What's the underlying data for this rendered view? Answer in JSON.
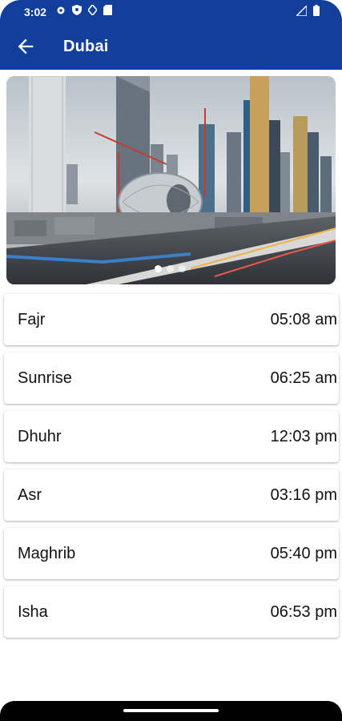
{
  "status_bar": {
    "time": "3:02",
    "left_icons": [
      "gear-icon",
      "shield-icon",
      "diamond-icon",
      "sim-card-icon"
    ],
    "right_icons": [
      "signal-icon",
      "battery-icon"
    ]
  },
  "app_bar": {
    "title": "Dubai",
    "back_icon": "arrow-back-icon",
    "color": "#123f9c"
  },
  "carousel": {
    "image_subject": "Dubai skyline",
    "page_count": 3,
    "active_index": 0
  },
  "prayers": [
    {
      "name": "Fajr",
      "time": "05:08 am"
    },
    {
      "name": "Sunrise",
      "time": "06:25 am"
    },
    {
      "name": "Dhuhr",
      "time": "12:03 pm"
    },
    {
      "name": "Asr",
      "time": "03:16 pm"
    },
    {
      "name": "Maghrib",
      "time": "05:40 pm"
    },
    {
      "name": "Isha",
      "time": "06:53 pm"
    }
  ]
}
